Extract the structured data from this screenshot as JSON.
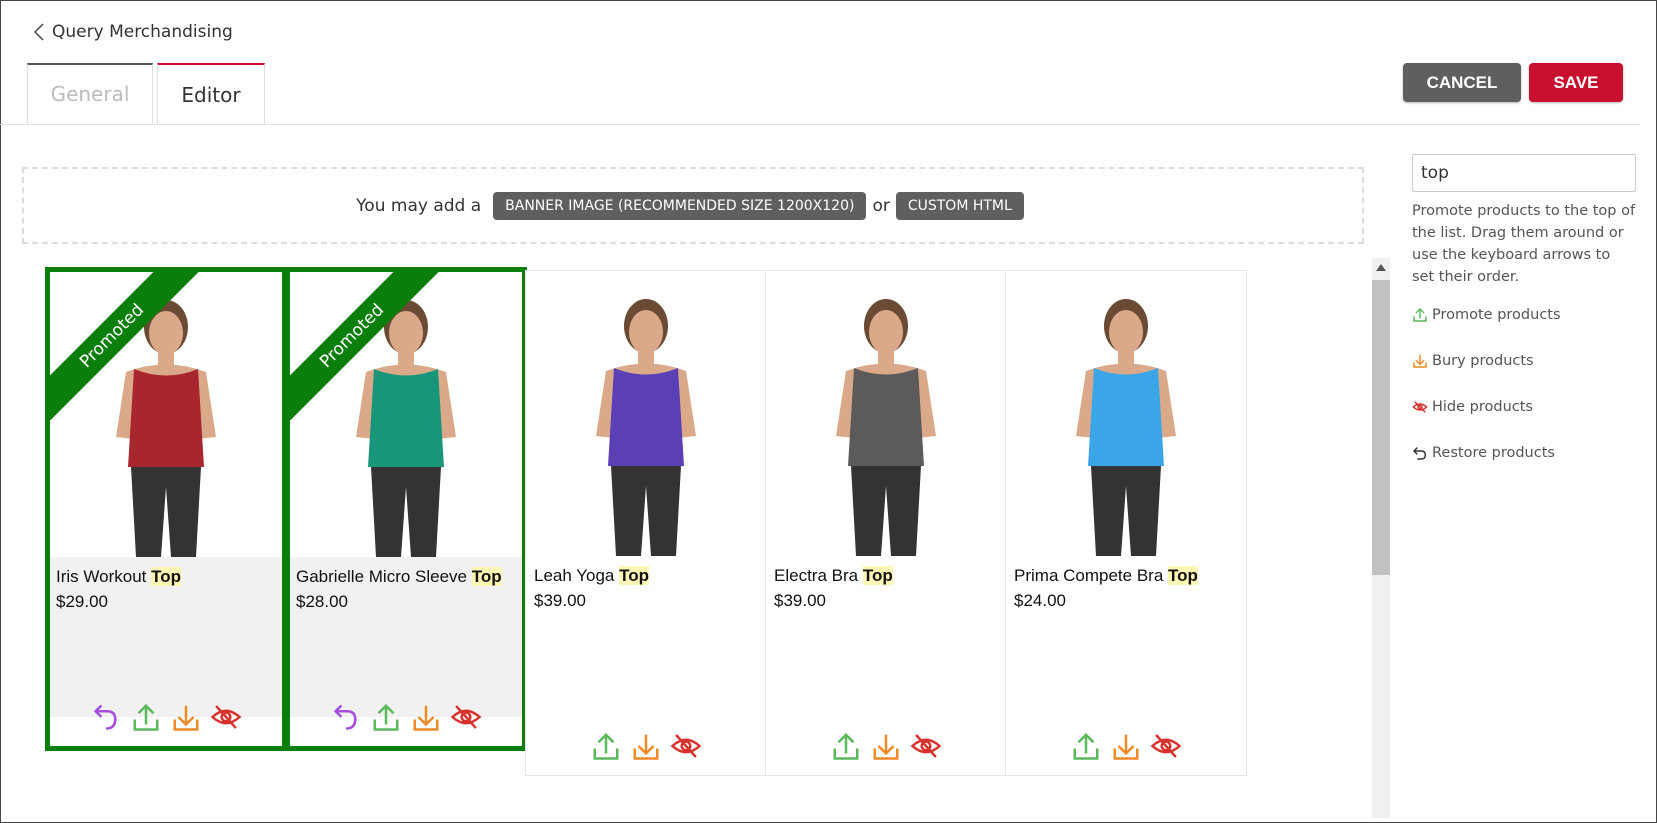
{
  "header": {
    "back_label": "Query Merchandising",
    "cancel_label": "CANCEL",
    "save_label": "SAVE"
  },
  "tabs": [
    {
      "label": "General"
    },
    {
      "label": "Editor"
    }
  ],
  "banner": {
    "prefix": "You may add a",
    "banner_button": "BANNER IMAGE (RECOMMENDED SIZE 1200X120)",
    "or": "or",
    "html_button": "CUSTOM HTML"
  },
  "search": {
    "value": "top"
  },
  "help": "Promote products to the top of the list. Drag them around or use the keyboard arrows to set their order.",
  "legend": {
    "promote": "Promote products",
    "bury": "Bury products",
    "hide": "Hide products",
    "restore": "Restore products"
  },
  "ribbon_label": "Promoted",
  "products": [
    {
      "name": "Iris Workout",
      "keyword": "Top",
      "price": "$29.00",
      "promoted": true,
      "color": "#a8262d"
    },
    {
      "name": "Gabrielle Micro Sleeve",
      "keyword": "Top",
      "price": "$28.00",
      "promoted": true,
      "color": "#19967a"
    },
    {
      "name": "Leah Yoga",
      "keyword": "Top",
      "price": "$39.00",
      "promoted": false,
      "color": "#5a3fb5"
    },
    {
      "name": "Electra Bra",
      "keyword": "Top",
      "price": "$39.00",
      "promoted": false,
      "color": "#5c5a5a"
    },
    {
      "name": "Prima Compete Bra",
      "keyword": "Top",
      "price": "$24.00",
      "promoted": false,
      "color": "#3aa6e8"
    }
  ],
  "colors": {
    "accent": "#c8102e",
    "promoted": "#0a7e0a",
    "promote_icon": "#5cb85c",
    "bury_icon": "#f08a24",
    "hide_icon": "#d9312b",
    "restore_icon": "#a64ee0"
  }
}
